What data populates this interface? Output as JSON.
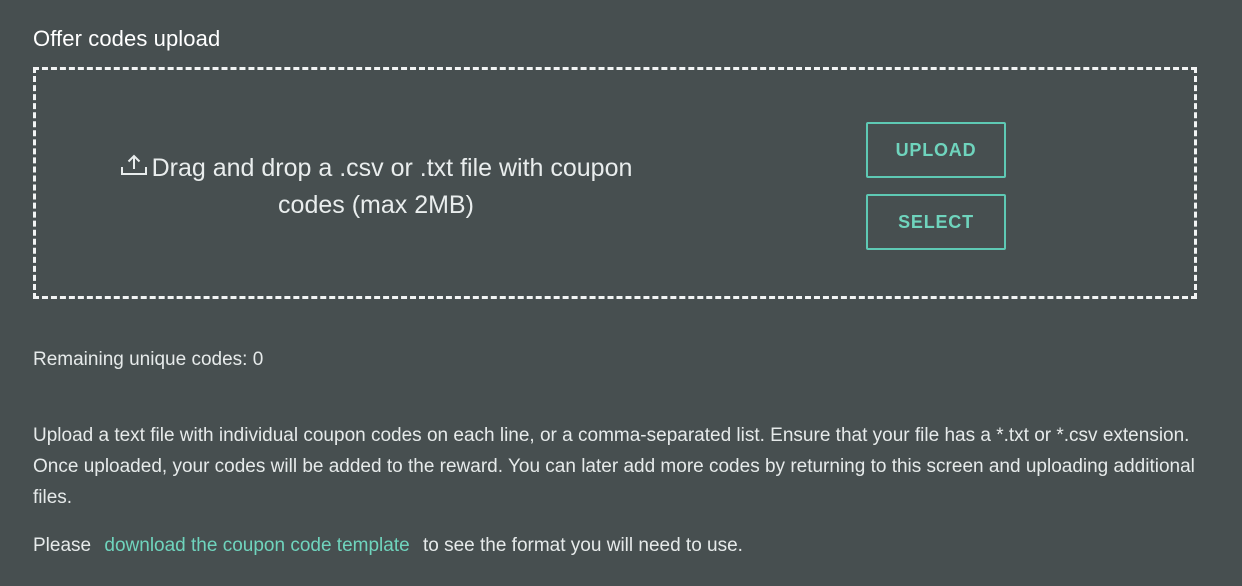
{
  "section": {
    "title": "Offer codes upload"
  },
  "dropzone": {
    "icon": "upload-icon",
    "message": "Drag and drop a .csv or .txt file with coupon codes (max 2MB)",
    "upload_label": "UPLOAD",
    "select_label": "SELECT"
  },
  "remaining": {
    "text": "Remaining unique codes: 0"
  },
  "help": {
    "paragraph": "Upload a text file with individual coupon codes on each line, or a comma-separated list. Ensure that your file has a *.txt or *.csv extension. Once uploaded, your codes will be added to the reward. You can later add more codes by returning to this screen and uploading additional files.",
    "template_prefix": "Please",
    "template_link": "download the coupon code template",
    "template_suffix": "to see the format you will need to use."
  },
  "colors": {
    "background": "#474f50",
    "accent": "#6fd4bd",
    "text": "#e6eaea",
    "border": "#f2f4f4"
  }
}
